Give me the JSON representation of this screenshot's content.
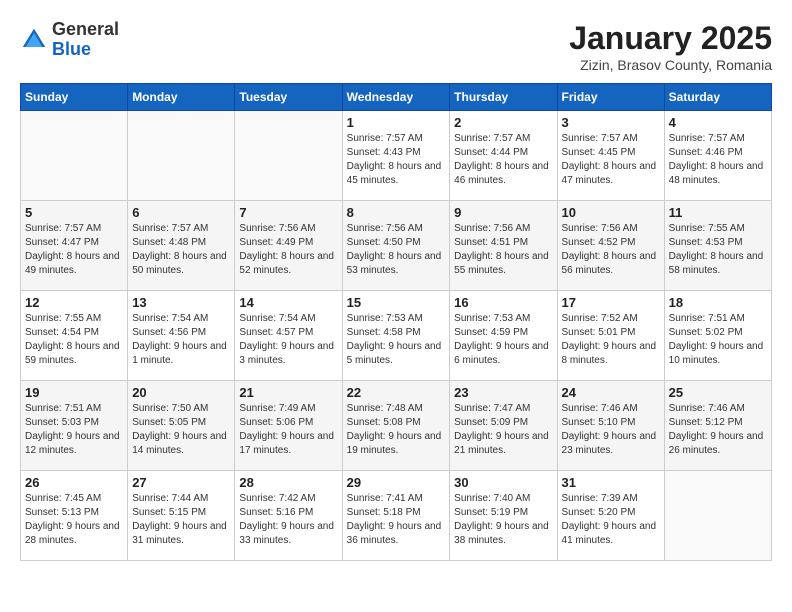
{
  "header": {
    "logo_general": "General",
    "logo_blue": "Blue",
    "month_title": "January 2025",
    "location": "Zizin, Brasov County, Romania"
  },
  "weekdays": [
    "Sunday",
    "Monday",
    "Tuesday",
    "Wednesday",
    "Thursday",
    "Friday",
    "Saturday"
  ],
  "weeks": [
    [
      {
        "day": "",
        "info": ""
      },
      {
        "day": "",
        "info": ""
      },
      {
        "day": "",
        "info": ""
      },
      {
        "day": "1",
        "info": "Sunrise: 7:57 AM\nSunset: 4:43 PM\nDaylight: 8 hours\nand 45 minutes."
      },
      {
        "day": "2",
        "info": "Sunrise: 7:57 AM\nSunset: 4:44 PM\nDaylight: 8 hours\nand 46 minutes."
      },
      {
        "day": "3",
        "info": "Sunrise: 7:57 AM\nSunset: 4:45 PM\nDaylight: 8 hours\nand 47 minutes."
      },
      {
        "day": "4",
        "info": "Sunrise: 7:57 AM\nSunset: 4:46 PM\nDaylight: 8 hours\nand 48 minutes."
      }
    ],
    [
      {
        "day": "5",
        "info": "Sunrise: 7:57 AM\nSunset: 4:47 PM\nDaylight: 8 hours\nand 49 minutes."
      },
      {
        "day": "6",
        "info": "Sunrise: 7:57 AM\nSunset: 4:48 PM\nDaylight: 8 hours\nand 50 minutes."
      },
      {
        "day": "7",
        "info": "Sunrise: 7:56 AM\nSunset: 4:49 PM\nDaylight: 8 hours\nand 52 minutes."
      },
      {
        "day": "8",
        "info": "Sunrise: 7:56 AM\nSunset: 4:50 PM\nDaylight: 8 hours\nand 53 minutes."
      },
      {
        "day": "9",
        "info": "Sunrise: 7:56 AM\nSunset: 4:51 PM\nDaylight: 8 hours\nand 55 minutes."
      },
      {
        "day": "10",
        "info": "Sunrise: 7:56 AM\nSunset: 4:52 PM\nDaylight: 8 hours\nand 56 minutes."
      },
      {
        "day": "11",
        "info": "Sunrise: 7:55 AM\nSunset: 4:53 PM\nDaylight: 8 hours\nand 58 minutes."
      }
    ],
    [
      {
        "day": "12",
        "info": "Sunrise: 7:55 AM\nSunset: 4:54 PM\nDaylight: 8 hours\nand 59 minutes."
      },
      {
        "day": "13",
        "info": "Sunrise: 7:54 AM\nSunset: 4:56 PM\nDaylight: 9 hours\nand 1 minute."
      },
      {
        "day": "14",
        "info": "Sunrise: 7:54 AM\nSunset: 4:57 PM\nDaylight: 9 hours\nand 3 minutes."
      },
      {
        "day": "15",
        "info": "Sunrise: 7:53 AM\nSunset: 4:58 PM\nDaylight: 9 hours\nand 5 minutes."
      },
      {
        "day": "16",
        "info": "Sunrise: 7:53 AM\nSunset: 4:59 PM\nDaylight: 9 hours\nand 6 minutes."
      },
      {
        "day": "17",
        "info": "Sunrise: 7:52 AM\nSunset: 5:01 PM\nDaylight: 9 hours\nand 8 minutes."
      },
      {
        "day": "18",
        "info": "Sunrise: 7:51 AM\nSunset: 5:02 PM\nDaylight: 9 hours\nand 10 minutes."
      }
    ],
    [
      {
        "day": "19",
        "info": "Sunrise: 7:51 AM\nSunset: 5:03 PM\nDaylight: 9 hours\nand 12 minutes."
      },
      {
        "day": "20",
        "info": "Sunrise: 7:50 AM\nSunset: 5:05 PM\nDaylight: 9 hours\nand 14 minutes."
      },
      {
        "day": "21",
        "info": "Sunrise: 7:49 AM\nSunset: 5:06 PM\nDaylight: 9 hours\nand 17 minutes."
      },
      {
        "day": "22",
        "info": "Sunrise: 7:48 AM\nSunset: 5:08 PM\nDaylight: 9 hours\nand 19 minutes."
      },
      {
        "day": "23",
        "info": "Sunrise: 7:47 AM\nSunset: 5:09 PM\nDaylight: 9 hours\nand 21 minutes."
      },
      {
        "day": "24",
        "info": "Sunrise: 7:46 AM\nSunset: 5:10 PM\nDaylight: 9 hours\nand 23 minutes."
      },
      {
        "day": "25",
        "info": "Sunrise: 7:46 AM\nSunset: 5:12 PM\nDaylight: 9 hours\nand 26 minutes."
      }
    ],
    [
      {
        "day": "26",
        "info": "Sunrise: 7:45 AM\nSunset: 5:13 PM\nDaylight: 9 hours\nand 28 minutes."
      },
      {
        "day": "27",
        "info": "Sunrise: 7:44 AM\nSunset: 5:15 PM\nDaylight: 9 hours\nand 31 minutes."
      },
      {
        "day": "28",
        "info": "Sunrise: 7:42 AM\nSunset: 5:16 PM\nDaylight: 9 hours\nand 33 minutes."
      },
      {
        "day": "29",
        "info": "Sunrise: 7:41 AM\nSunset: 5:18 PM\nDaylight: 9 hours\nand 36 minutes."
      },
      {
        "day": "30",
        "info": "Sunrise: 7:40 AM\nSunset: 5:19 PM\nDaylight: 9 hours\nand 38 minutes."
      },
      {
        "day": "31",
        "info": "Sunrise: 7:39 AM\nSunset: 5:20 PM\nDaylight: 9 hours\nand 41 minutes."
      },
      {
        "day": "",
        "info": ""
      }
    ]
  ]
}
